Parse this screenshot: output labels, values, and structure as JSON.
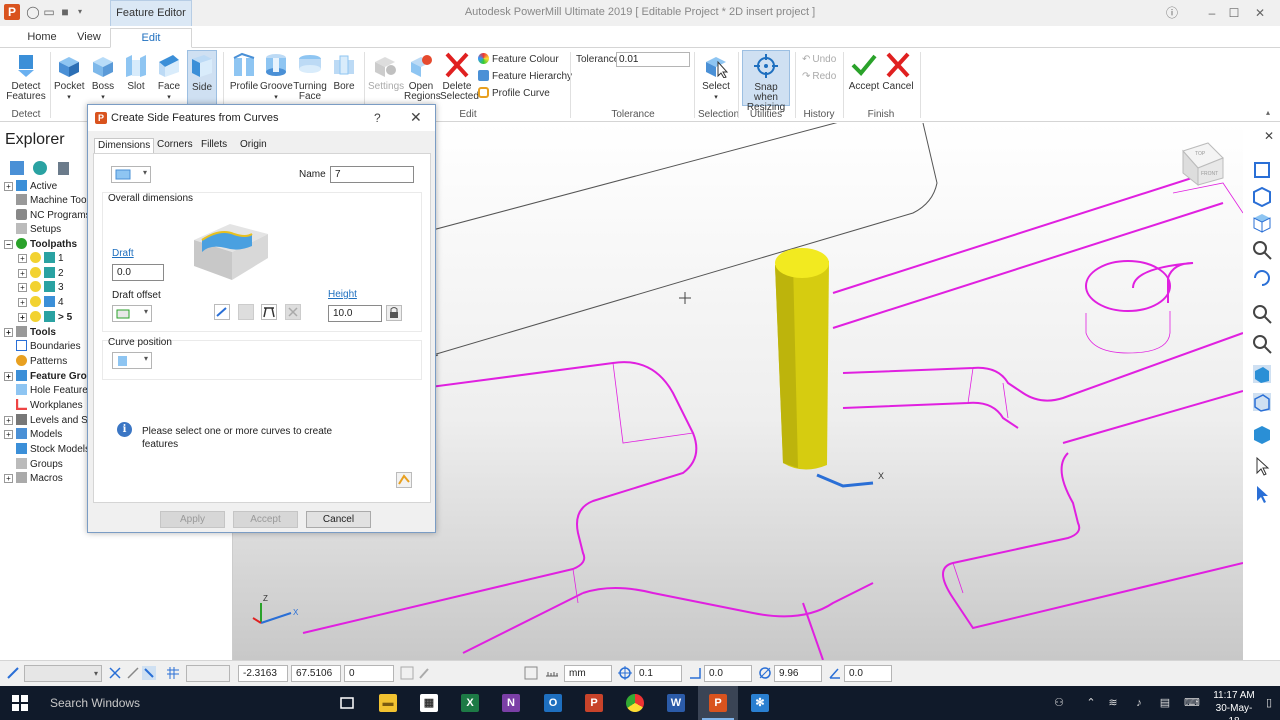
{
  "window": {
    "title": "Autodesk PowerMill Ultimate 2019   [ Editable Project * 2D insert project ]",
    "context_tab": "Feature Editor"
  },
  "ribbon_tabs": [
    "Home",
    "View",
    "Edit"
  ],
  "ribbon": {
    "detect_features": "Detect\nFeatures",
    "pocket": "Pocket",
    "boss": "Boss",
    "slot": "Slot",
    "face": "Face",
    "side": "Side",
    "profile": "Profile",
    "groove": "Groove",
    "turning_face": "Turning\nFace",
    "bore": "Bore",
    "settings": "Settings",
    "open_regions": "Open\nRegions",
    "delete_selected": "Delete\nSelected",
    "feature_colour": "Feature Colour",
    "feature_hierarchy": "Feature Hierarchy",
    "profile_curve": "Profile Curve",
    "tolerance_label": "Tolerance",
    "tolerance_value": "0.01",
    "select": "Select",
    "snap_when_resizing": "Snap when\nResizing",
    "undo": "Undo",
    "redo": "Redo",
    "accept": "Accept",
    "cancel": "Cancel",
    "groups": {
      "detect": "Detect",
      "edit": "Edit",
      "tolerance": "Tolerance",
      "selection": "Selection",
      "utilities": "Utilities",
      "history": "History",
      "finish": "Finish"
    }
  },
  "explorer": {
    "title": "Explorer",
    "items": {
      "active": "Active",
      "machine_tools": "Machine Tools",
      "nc_programs": "NC Programs",
      "setups": "Setups",
      "toolpaths": "Toolpaths",
      "tp1": "1",
      "tp2": "2",
      "tp3": "3",
      "tp4": "4",
      "tp5": "> 5",
      "tools": "Tools",
      "boundaries": "Boundaries",
      "patterns": "Patterns",
      "feature_groups": "Feature Groups",
      "hole_feature_sets": "Hole Feature Sets",
      "workplanes": "Workplanes",
      "levels_and_sets": "Levels and Sets",
      "models": "Models",
      "stock_models": "Stock Models",
      "groups": "Groups",
      "macros": "Macros"
    }
  },
  "dialog": {
    "title": "Create Side Features from Curves",
    "help": "?",
    "tabs": [
      "Dimensions",
      "Corners",
      "Fillets",
      "Origin"
    ],
    "name_label": "Name",
    "name_value": "7",
    "overall_dimensions": "Overall dimensions",
    "draft_label": "Draft",
    "draft_value": "0.0",
    "draft_offset_label": "Draft offset",
    "height_label": "Height",
    "height_value": "10.0",
    "curve_position": "Curve position",
    "info": "Please select one or more curves to create features",
    "apply": "Apply",
    "accept": "Accept",
    "cancel": "Cancel"
  },
  "viewport": {
    "axis_x": "X",
    "axis_z": "Z",
    "cube_top": "TOP",
    "cube_front": "FRONT"
  },
  "statusbar": {
    "x": "-2.3163",
    "y": "67.5106",
    "z": "0",
    "units": "mm",
    "tol": "0.1",
    "val1": "0.0",
    "val2": "9.96",
    "val3": "0.0"
  },
  "taskbar": {
    "search": "Search Windows",
    "time": "11:17 AM",
    "date": "30-May-18"
  },
  "colors": {
    "accent": "#1e6fbf",
    "feature_magenta": "#e020e0",
    "tool_yellow": "#e8e01a"
  }
}
